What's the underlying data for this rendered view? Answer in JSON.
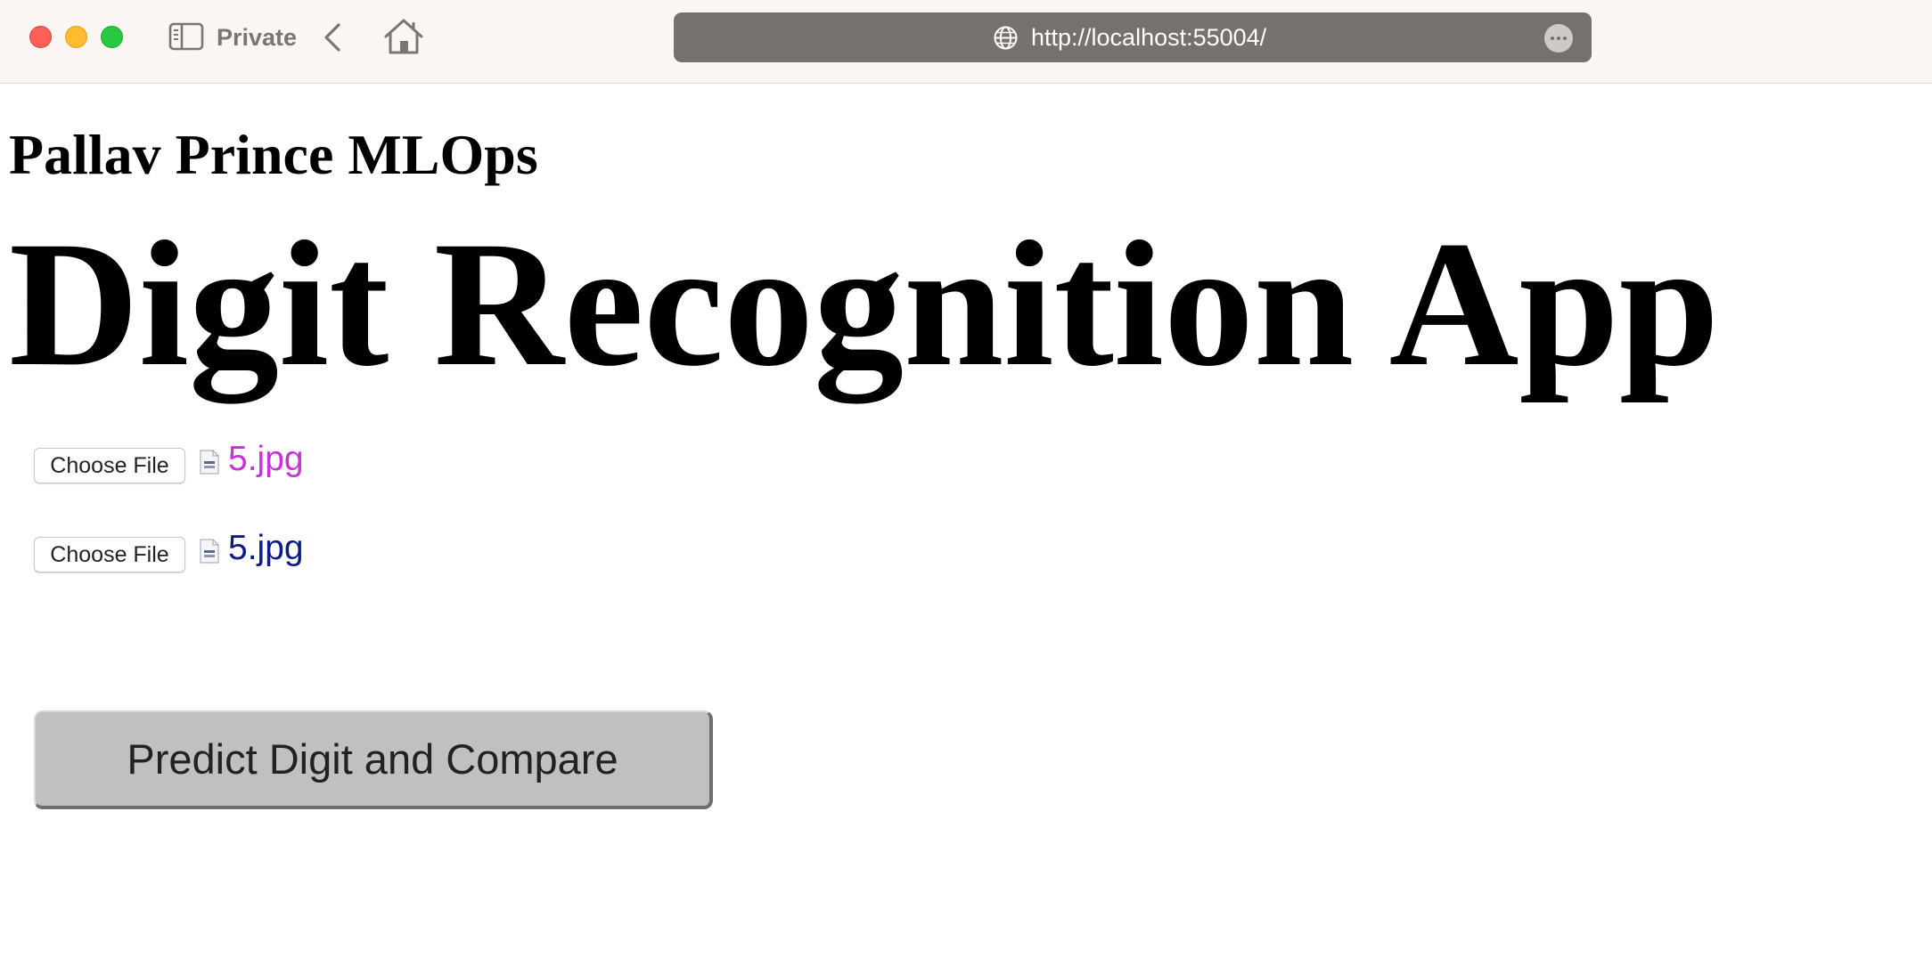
{
  "browser": {
    "mode_label": "Private",
    "url": "http://localhost:55004/"
  },
  "page": {
    "sub_heading": "Pallav Prince MLOps",
    "heading": "Digit Recognition App",
    "file_inputs": [
      {
        "button_label": "Choose File",
        "file_name": "5.jpg",
        "name_color": "#c832d6"
      },
      {
        "button_label": "Choose File",
        "file_name": "5.jpg",
        "name_color": "#0c1a8a"
      }
    ],
    "submit_label": "Predict Digit and Compare"
  },
  "icons": {
    "sidebar": "sidebar-icon",
    "back": "chevron-left-icon",
    "home": "home-icon",
    "site": "globe-icon",
    "more": "ellipsis-icon",
    "file": "file-icon"
  }
}
